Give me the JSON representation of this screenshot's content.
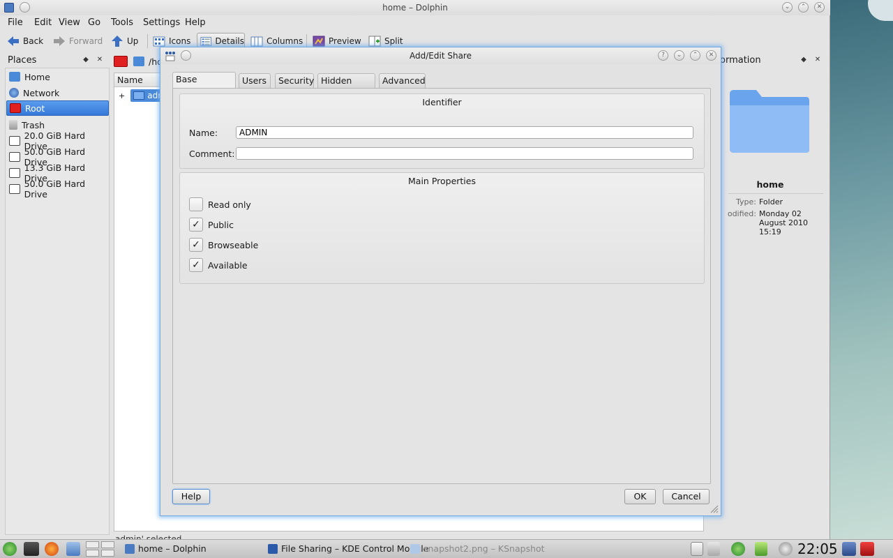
{
  "dolphin": {
    "title": "home – Dolphin",
    "menu": [
      "File",
      "Edit",
      "View",
      "Go",
      "Tools",
      "Settings",
      "Help"
    ],
    "toolbar": {
      "back": "Back",
      "forward": "Forward",
      "up": "Up",
      "icons": "Icons",
      "details": "Details",
      "columns": "Columns",
      "preview": "Preview",
      "split": "Split"
    },
    "places": {
      "title": "Places",
      "items": [
        "Home",
        "Network",
        "Root",
        "Trash",
        "20.0 GiB Hard Drive",
        "50.0 GiB Hard Drive",
        "13.3 GiB Hard Drive",
        "50.0 GiB Hard Drive"
      ],
      "selected": "Root"
    },
    "location": "/ho",
    "column_name": "Name",
    "tree_item": "adm",
    "status": "admin' selected",
    "info": {
      "title": "ormation",
      "name": "home",
      "type_label": "Type:",
      "type_value": "Folder",
      "modified_label": "odified:",
      "modified_value": "Monday 02 August 2010 15:19"
    }
  },
  "dialog": {
    "title": "Add/Edit Share",
    "tabs": [
      "Base Settings",
      "Users",
      "Security",
      "Hidden Files",
      "Advanced"
    ],
    "identifier": {
      "title": "Identifier",
      "name_label": "Name:",
      "name_value": "ADMIN",
      "comment_label": "Comment:",
      "comment_value": ""
    },
    "main_properties": {
      "title": "Main Properties",
      "read_only": "Read only",
      "public": "Public",
      "browseable": "Browseable",
      "available": "Available"
    },
    "buttons": {
      "help": "Help",
      "ok": "OK",
      "cancel": "Cancel"
    }
  },
  "taskbar": {
    "tasks": [
      "home – Dolphin",
      "File Sharing – KDE Control Module",
      "snapshot2.png – KSnapshot"
    ],
    "clock": "22:05"
  }
}
